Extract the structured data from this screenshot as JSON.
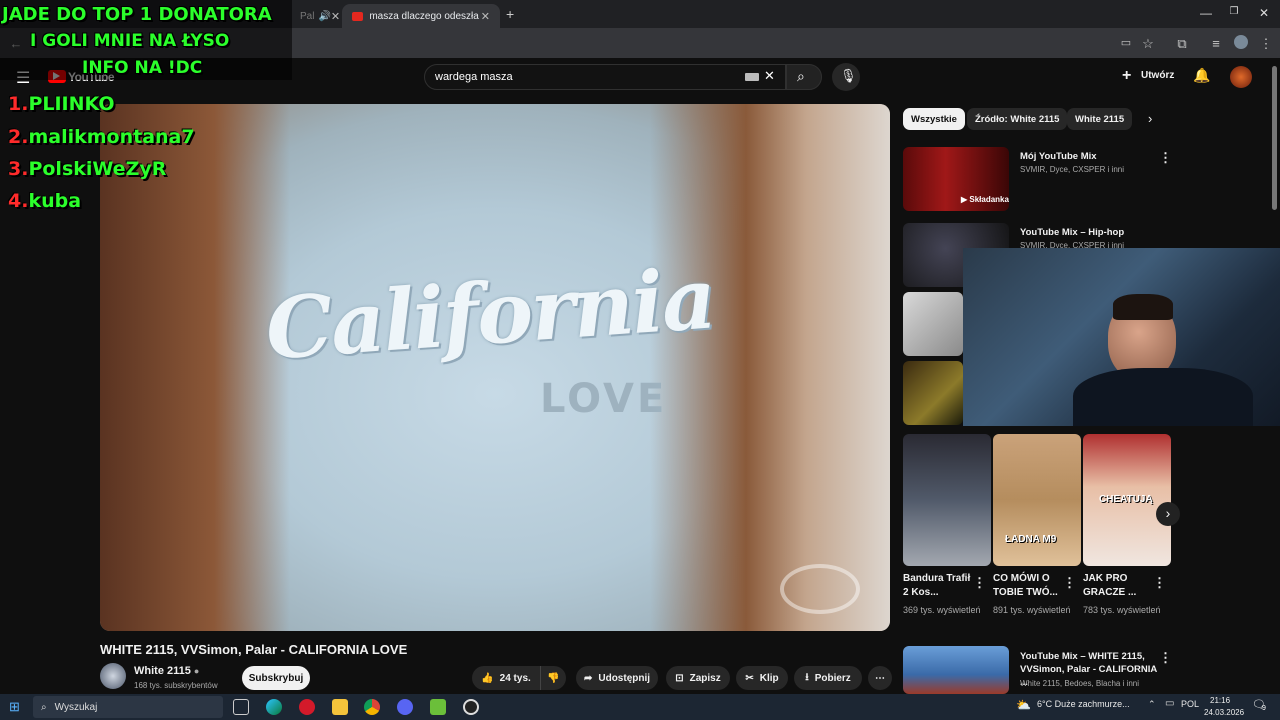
{
  "browser": {
    "tabs": [
      {
        "label": "Pal"
      },
      {
        "label": "masza dlaczego odeszła - YouT"
      }
    ],
    "new_tab": "+"
  },
  "youtube": {
    "logo": "YouTube",
    "search_value": "wardega masza",
    "create_label": "Utwórz"
  },
  "overlay": {
    "lines": [
      "JADE DO TOP 1 DONATORA",
      "I GOLI MNIE NA ŁYSO",
      "INFO NA !DC"
    ],
    "donors": [
      {
        "rank": "1.",
        "name": "PLIINKO"
      },
      {
        "rank": "2.",
        "name": "malikmontana7"
      },
      {
        "rank": "3.",
        "name": "PolskiWeZyR"
      },
      {
        "rank": "4.",
        "name": "kuba"
      }
    ]
  },
  "video": {
    "shirt_text": "California",
    "shirt_sub": "LOVE",
    "title": "WHITE 2115, VVSimon, Palar - CALIFORNIA LOVE",
    "channel": "White 2115",
    "subscribers": "168 tys. subskrybentów",
    "subscribe_label": "Subskrybuj",
    "likes": "24 tys.",
    "share_label": "Udostępnij",
    "save_label": "Zapisz",
    "clip_label": "Klip",
    "download_label": "Pobierz"
  },
  "chips": [
    "Wszystkie",
    "Źródło: White 2115",
    "White 2115"
  ],
  "recommendations": [
    {
      "title": "Mój YouTube Mix",
      "meta": "SVMIR, Dyce, CXSPER i inni",
      "badge": "Składanka"
    },
    {
      "title": "YouTube Mix – Hip-hop",
      "meta": "SVMIR, Dyce, CXSPER i inni",
      "badge": ""
    }
  ],
  "shorts": [
    {
      "title": "Bandura Trafił 2 Kos...",
      "views": "369 tys. wyświetleń",
      "overlay": ""
    },
    {
      "title": "CO MÓWI O TOBIE TWÓ...",
      "views": "891 tys. wyświetleń",
      "overlay": "ŁADNA M9"
    },
    {
      "title": "JAK PRO GRACZE ...",
      "views": "783 tys. wyświetleń",
      "overlay": "CHEATUJĄ"
    }
  ],
  "bottom_rec": {
    "title": "YouTube Mix – WHITE 2115, VVSimon, Palar - CALIFORNIA ...",
    "meta": "White 2115, Bedoes, Blacha i inni"
  },
  "taskbar": {
    "search_placeholder": "Wyszukaj",
    "weather": "6°C  Duże zachmurze...",
    "lang": "POL",
    "time": "21:16",
    "date": "24.03.2026",
    "notif_count": "9"
  }
}
